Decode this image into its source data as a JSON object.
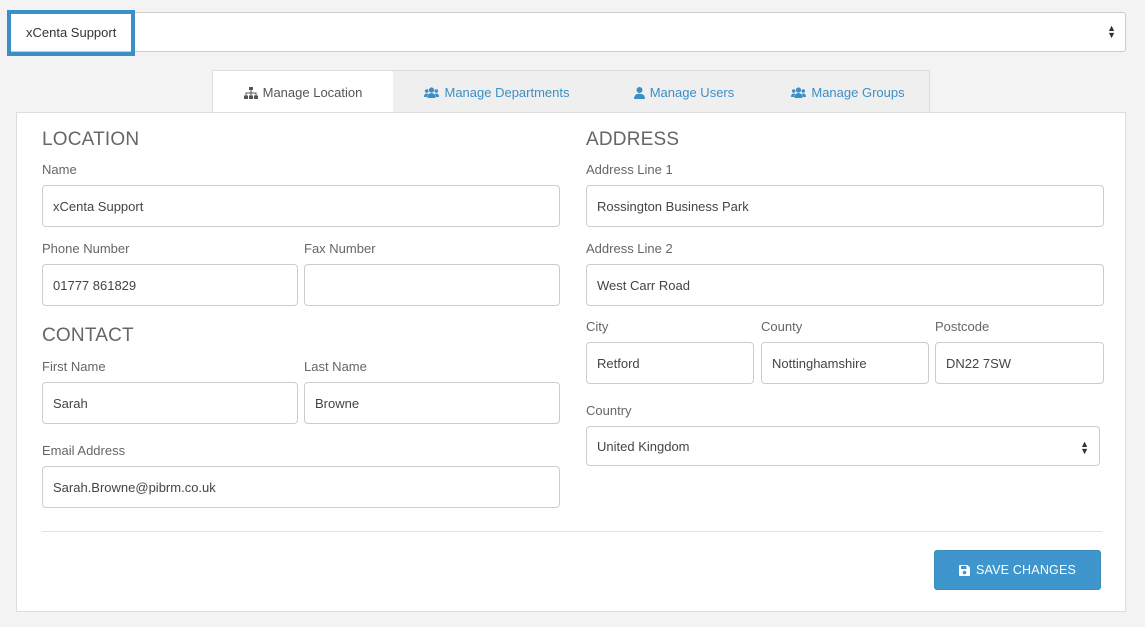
{
  "location_selector": {
    "value": "xCenta Support"
  },
  "tabs": [
    {
      "label": "Manage Location",
      "icon": "sitemap-icon"
    },
    {
      "label": "Manage Departments",
      "icon": "users-icon"
    },
    {
      "label": "Manage Users",
      "icon": "user-icon"
    },
    {
      "label": "Manage Groups",
      "icon": "users-icon"
    }
  ],
  "location": {
    "heading": "LOCATION",
    "name_label": "Name",
    "name_value": "xCenta Support",
    "phone_label": "Phone Number",
    "phone_value": "01777 861829",
    "fax_label": "Fax Number",
    "fax_value": ""
  },
  "contact": {
    "heading": "CONTACT",
    "first_name_label": "First Name",
    "first_name_value": "Sarah",
    "last_name_label": "Last Name",
    "last_name_value": "Browne",
    "email_label": "Email Address",
    "email_value": "Sarah.Browne@pibrm.co.uk"
  },
  "address": {
    "heading": "ADDRESS",
    "line1_label": "Address Line 1",
    "line1_value": "Rossington Business Park",
    "line2_label": "Address Line 2",
    "line2_value": "West Carr Road",
    "city_label": "City",
    "city_value": "Retford",
    "county_label": "County",
    "county_value": "Nottinghamshire",
    "postcode_label": "Postcode",
    "postcode_value": "DN22 7SW",
    "country_label": "Country",
    "country_value": "United Kingdom"
  },
  "actions": {
    "save_label": "SAVE CHANGES"
  },
  "colors": {
    "accent": "#3f96cc",
    "highlight": "#3a8fc6"
  }
}
